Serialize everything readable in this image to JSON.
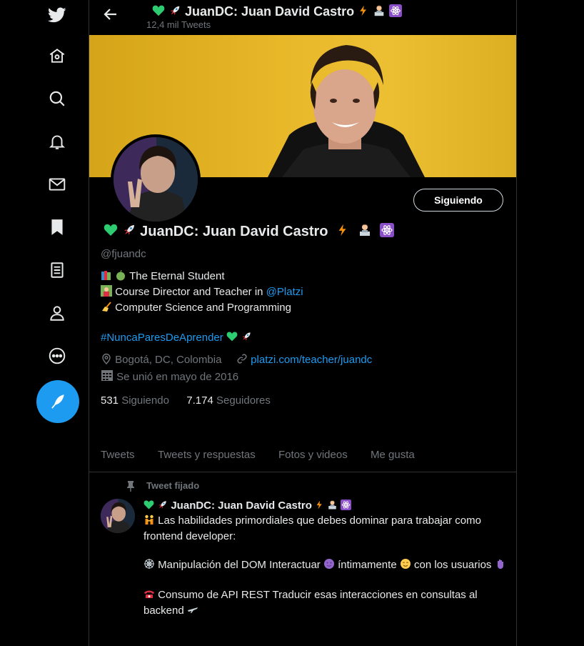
{
  "header": {
    "title": "JuanDC: Juan David Castro",
    "tweet_count": "12,4 mil Tweets"
  },
  "profile": {
    "display_name": "JuanDC: Juan David Castro",
    "handle": "@fjuandc",
    "follow_button": "Siguiendo",
    "bio_line1": "The Eternal Student",
    "bio_line2_prefix": "Course Director and Teacher in ",
    "bio_line2_mention": "@Platzi",
    "bio_line3": "Computer Science and Programming",
    "bio_hashtag": "#NuncaParesDeAprender",
    "location": "Bogotá, DC, Colombia",
    "website": "platzi.com/teacher/juandc",
    "joined": "Se unió en mayo de 2016",
    "following_count": "531",
    "following_label": "Siguiendo",
    "followers_count": "7.174",
    "followers_label": "Seguidores"
  },
  "tabs": [
    "Tweets",
    "Tweets y respuestas",
    "Fotos y videos",
    "Me gusta"
  ],
  "pinned_tweet": {
    "pinned_label": "Tweet fijado",
    "author": "JuanDC: Juan David Castro",
    "line1": "Las habilidades primordiales que debes dominar para trabajar como frontend developer:",
    "line2a": "Manipulación del DOM Interactuar",
    "line2b": "íntimamente",
    "line2c": "con los usuarios",
    "line3": "Consumo de API REST Traducir esas interacciones en consultas al backend"
  },
  "colors": {
    "accent": "#1d9bf0",
    "background": "#000000",
    "text": "#e7e9ea",
    "muted": "#71767b",
    "banner": "#e8b829"
  },
  "icons": {
    "nav": [
      "twitter-logo-icon",
      "home-icon",
      "explore-icon",
      "notifications-icon",
      "messages-icon",
      "bookmarks-icon",
      "lists-icon",
      "profile-icon",
      "more-icon",
      "compose-tweet-icon"
    ]
  }
}
